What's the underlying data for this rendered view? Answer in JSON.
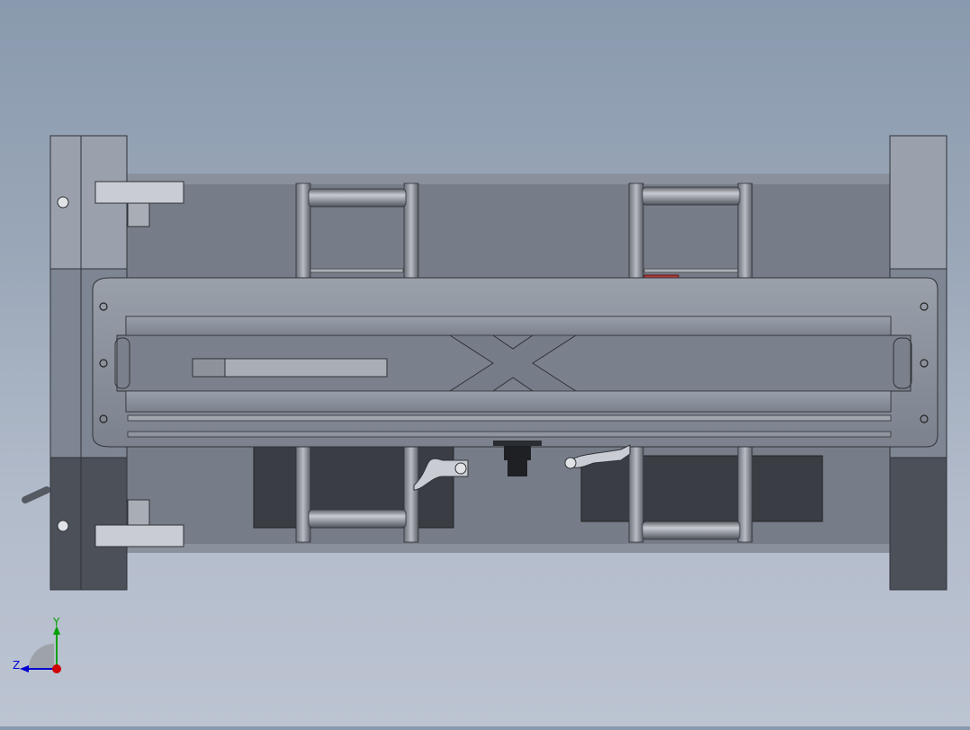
{
  "window": {
    "title": ""
  },
  "triad": {
    "y_label": "Y",
    "z_label": "Z",
    "x_color": "#d00000",
    "y_color": "#00a000",
    "z_color": "#0000d0"
  },
  "model": {
    "colors": {
      "background_top": "#8a9aae",
      "background_bottom": "#bcc4d2",
      "frame_light": "#9aa1ad",
      "frame_mid": "#7f8693",
      "frame_dark": "#4c5058",
      "plate": "#777d88",
      "steel_bar": "#8b9099",
      "dark_block": "#3a3e44",
      "accent_red": "#b33a3a",
      "accent_green": "#3a7a3a"
    }
  }
}
